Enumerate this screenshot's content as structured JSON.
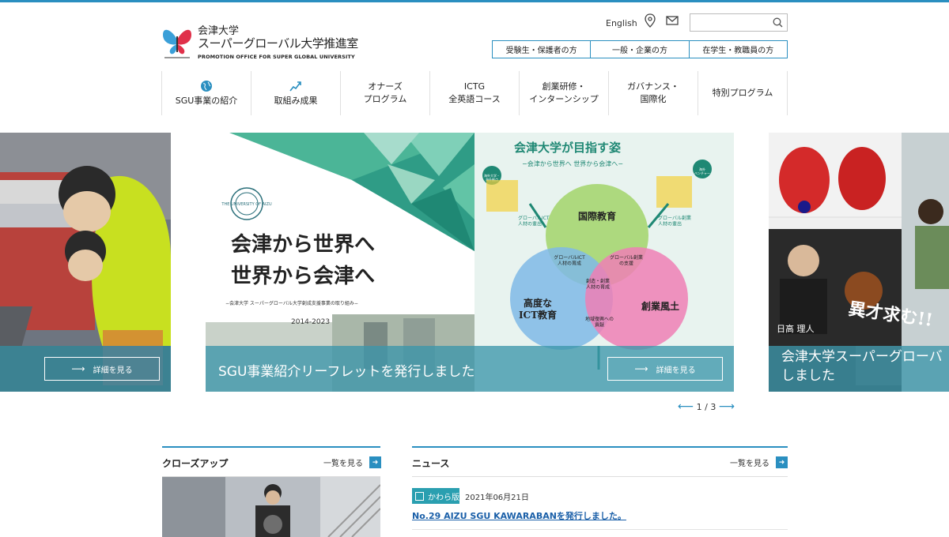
{
  "header": {
    "logo_line1": "会津大学",
    "logo_line2": "スーパーグローバル大学推進室",
    "logo_line3": "PROMOTION OFFICE FOR SUPER GLOBAL UNIVERSITY",
    "english_label": "English",
    "search_placeholder": "",
    "audience_links": [
      "受験生・保護者の方",
      "一般・企業の方",
      "在学生・教職員の方"
    ]
  },
  "nav": {
    "items": [
      {
        "label": "SGU事業の紹介",
        "icon": "globe-icon"
      },
      {
        "label": "取組み成果",
        "icon": "chart-line-icon"
      },
      {
        "label": "オナーズ\nプログラム"
      },
      {
        "label": "ICTG\n全英語コース"
      },
      {
        "label": "創業研修・\nインターンシップ"
      },
      {
        "label": "ガバナンス・\n国際化"
      },
      {
        "label": "特別プログラム"
      }
    ]
  },
  "carousel": {
    "left_detail": "詳細を見る",
    "center": {
      "caption": "SGU事業紹介リーフレットを発行しました",
      "detail": "詳細を見る",
      "leaflet_title_l1": "会津から世界へ",
      "leaflet_title_l2": "世界から会津へ",
      "leaflet_sub": "−会津大学 スーパーグローバル大学創成支援事業の取り組み−",
      "leaflet_years": "2014-2023",
      "uni_seal_text": "THE UNIVERSITY OF AIZU",
      "vision_title": "会津大学が目指す姿",
      "vision_sub": "−会津から世界へ 世界から会津へ−",
      "venn_top": "国際教育",
      "venn_left": "高度な\nICT教育",
      "venn_right": "創業風土",
      "venn_lt": "グローバルICT\n人材の育成",
      "venn_rt": "グローバル創業\nの支援",
      "venn_center": "創造・創業\n人材の育成",
      "venn_bottom": "地域復興への\n貢献",
      "badge_left": "海外大学・\n海外拠点",
      "badge_right": "海外\nベンチャー",
      "out_left": "グローバルICT\n人材の輩出",
      "out_right": "グローバル創業\n人材の輩出"
    },
    "right_caption": "会津大学スーパーグローバ\nしました",
    "right_poster_text": "異才求む!!",
    "right_poster_name": "日高 理人",
    "pager": "1 / 3"
  },
  "closeup": {
    "title": "クローズアップ",
    "more": "一覧を見る"
  },
  "news": {
    "title": "ニュース",
    "more": "一覧を見る",
    "items": [
      {
        "badge": "かわら版",
        "date": "2021年06月21日",
        "text": "No.29 AIZU SGU KAWARABANを発行しました。"
      }
    ]
  },
  "colors": {
    "accent": "#2a8fc0",
    "overlay": "#3c96aa",
    "badge": "#2a9fb0"
  }
}
